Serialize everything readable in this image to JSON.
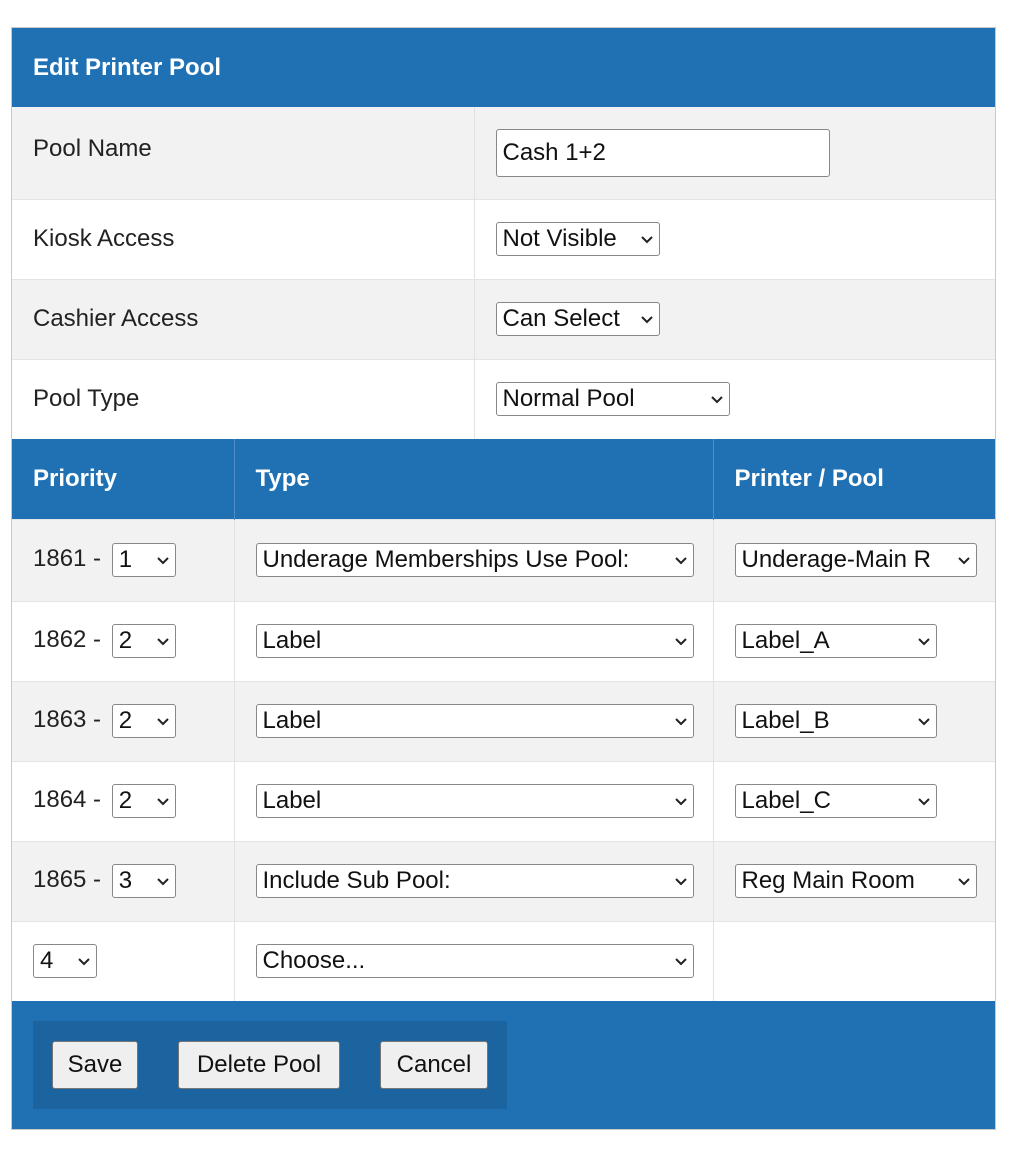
{
  "title": "Edit Printer Pool",
  "fields": {
    "pool_name": {
      "label": "Pool Name",
      "value": "Cash 1+2"
    },
    "kiosk_access": {
      "label": "Kiosk Access",
      "value": "Not Visible"
    },
    "cashier_access": {
      "label": "Cashier Access",
      "value": "Can Select"
    },
    "pool_type": {
      "label": "Pool Type",
      "value": "Normal Pool"
    }
  },
  "columns": {
    "priority": "Priority",
    "type": "Type",
    "printer": "Printer / Pool"
  },
  "rows": [
    {
      "id": "1861 -",
      "priority": "1",
      "type": "Underage Memberships Use Pool:",
      "printer": "Underage-Main R"
    },
    {
      "id": "1862 -",
      "priority": "2",
      "type": "Label",
      "printer": "Label_A"
    },
    {
      "id": "1863 -",
      "priority": "2",
      "type": "Label",
      "printer": "Label_B"
    },
    {
      "id": "1864 -",
      "priority": "2",
      "type": "Label",
      "printer": "Label_C"
    },
    {
      "id": "1865 -",
      "priority": "3",
      "type": "Include Sub Pool:",
      "printer": "Reg Main Room"
    }
  ],
  "new_row": {
    "priority": "4",
    "type": "Choose..."
  },
  "buttons": {
    "save": "Save",
    "delete": "Delete Pool",
    "cancel": "Cancel"
  },
  "icons": {
    "dropdown": "chevron-down-icon"
  },
  "colors": {
    "header_blue": "#1f71b4",
    "row_grey": "#f2f2f2"
  }
}
